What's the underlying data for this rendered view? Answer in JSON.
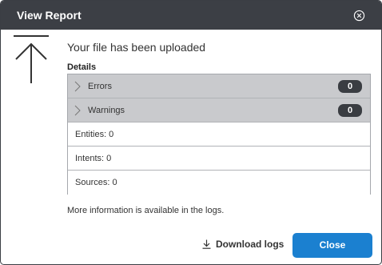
{
  "dialog": {
    "title": "View Report",
    "close_icon": "close-circle-icon"
  },
  "status": {
    "icon": "upload-arrow-icon",
    "message": "Your file has been uploaded"
  },
  "details": {
    "label": "Details",
    "expandable_rows": [
      {
        "label": "Errors",
        "count": "0",
        "icon": "chevron-right-icon"
      },
      {
        "label": "Warnings",
        "count": "0",
        "icon": "chevron-right-icon"
      }
    ],
    "static_rows": [
      {
        "label": "Entities: 0"
      },
      {
        "label": "Intents: 0"
      },
      {
        "label": "Sources: 0"
      }
    ]
  },
  "more_info": "More information is available in the logs.",
  "footer": {
    "download_label": "Download logs",
    "download_icon": "download-icon",
    "close_label": "Close"
  },
  "colors": {
    "titlebar": "#3c3f45",
    "primary_button": "#1b80d0",
    "expandable_row_bg": "#c9cacd",
    "badge_bg": "#3a3d42"
  }
}
